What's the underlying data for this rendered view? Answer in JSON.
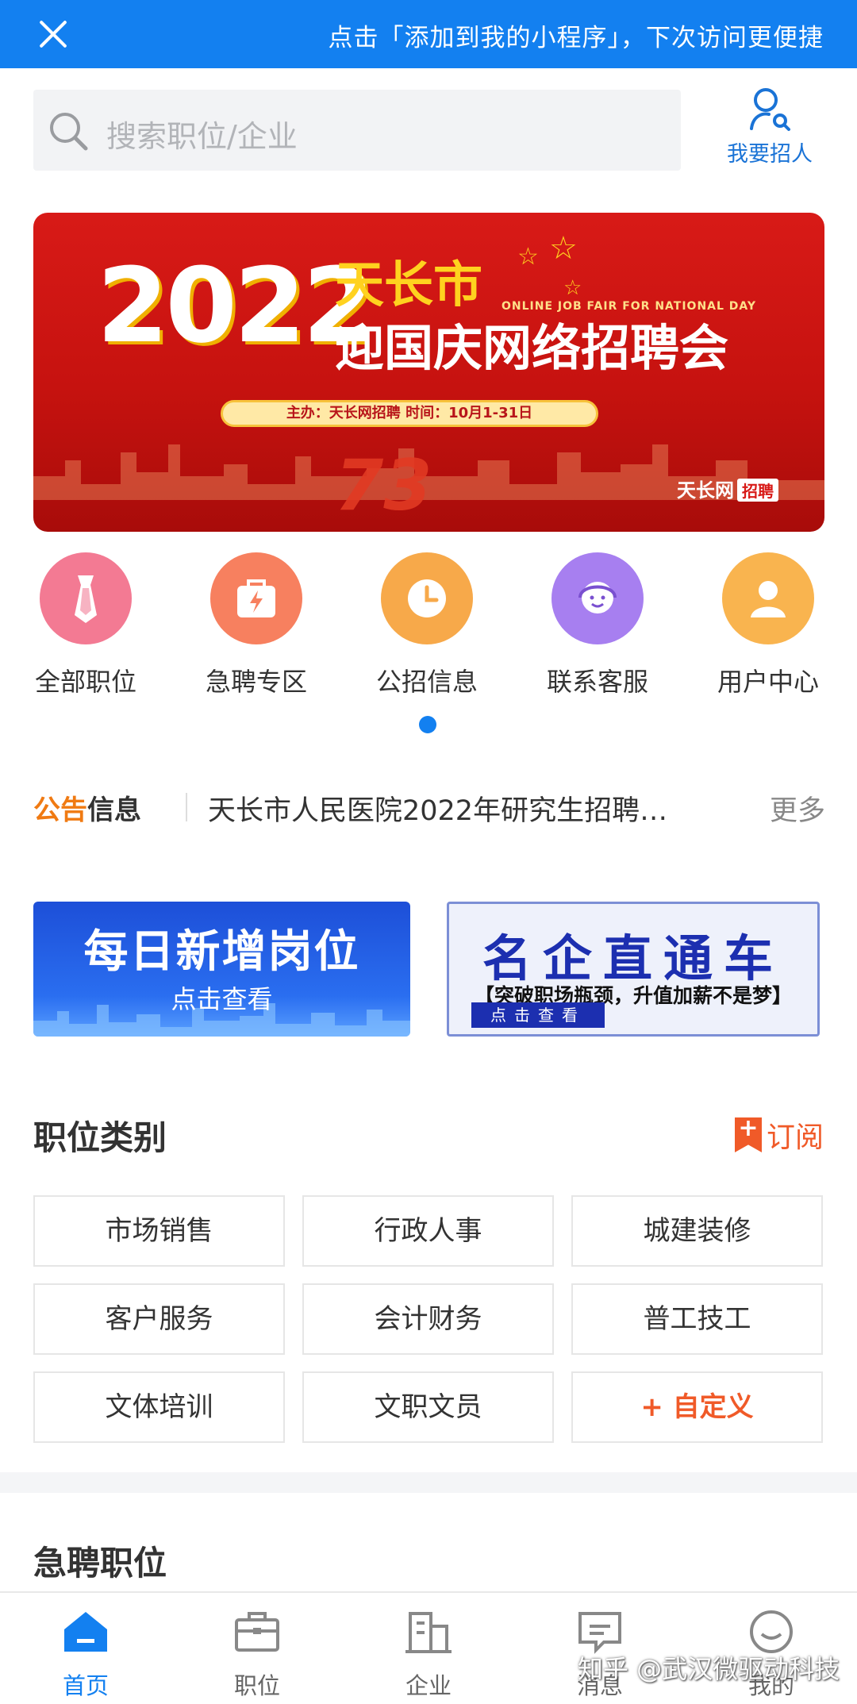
{
  "topbar": {
    "tip": "点击「添加到我的小程序」，下次访问更便捷"
  },
  "search": {
    "placeholder": "搜索职位/企业"
  },
  "recruit": {
    "label": "我要招人"
  },
  "banner": {
    "year": "2022",
    "city": "天长市",
    "subtitle_en": "ONLINE JOB FAIR FOR NATIONAL DAY",
    "headline": "迎国庆网络招聘会",
    "info": "主办：天长网招聘  时间：10月1-31日",
    "number": "73",
    "brand": "天长网",
    "brand_tag": "招聘"
  },
  "shortcuts": [
    {
      "label": "全部职位",
      "icon": "tie-icon",
      "color": "#f37a93"
    },
    {
      "label": "急聘专区",
      "icon": "urgent-bag-icon",
      "color": "#f7805f"
    },
    {
      "label": "公招信息",
      "icon": "clock-icon",
      "color": "#f7a94a"
    },
    {
      "label": "联系客服",
      "icon": "service-agent-icon",
      "color": "#a77ff0"
    },
    {
      "label": "用户中心",
      "icon": "user-icon",
      "color": "#f9b44f"
    }
  ],
  "notice": {
    "tag_a": "公告",
    "tag_b": "信息",
    "text": "天长市人民医院2022年研究生招聘…",
    "more": "更多"
  },
  "promo1": {
    "title": "每日新增岗位",
    "sub": "点击查看"
  },
  "promo2": {
    "title": "名企直通车",
    "sub": "【突破职场瓶颈，升值加薪不是梦】",
    "btn": "点击查看"
  },
  "categories": {
    "title": "职位类别",
    "subscribe": "订阅",
    "items": [
      "市场销售",
      "行政人事",
      "城建装修",
      "客户服务",
      "会计财务",
      "普工技工",
      "文体培训",
      "文职文员",
      "+ 自定义"
    ]
  },
  "urgent": {
    "title": "急聘职位"
  },
  "tabs": [
    {
      "label": "首页",
      "icon": "home-icon",
      "active": true
    },
    {
      "label": "职位",
      "icon": "briefcase-icon",
      "active": false
    },
    {
      "label": "企业",
      "icon": "building-icon",
      "active": false
    },
    {
      "label": "消息",
      "icon": "message-icon",
      "active": false
    },
    {
      "label": "我的",
      "icon": "profile-icon",
      "active": false
    }
  ],
  "watermark": "知乎 @武汉微驱动科技",
  "colors": {
    "primary": "#1380f0",
    "accent": "#f05a28",
    "notice": "#f07a12"
  }
}
